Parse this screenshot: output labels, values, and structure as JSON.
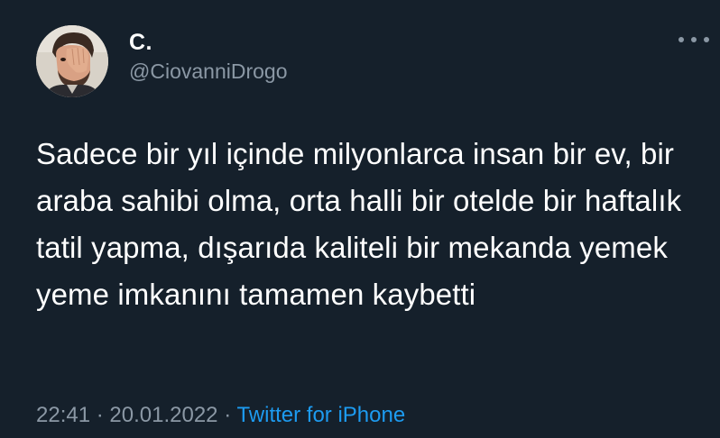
{
  "user": {
    "display_name": "C.",
    "handle": "@CiovanniDrogo"
  },
  "tweet": {
    "text": "Sadece bir yıl içinde milyonlarca insan bir ev, bir araba sahibi olma, orta halli bir otelde bir haftalık tatil yapma, dışarıda kaliteli bir mekanda yemek yeme imkanını tamamen kaybetti"
  },
  "meta": {
    "time": "22:41",
    "separator": "·",
    "date": "20.01.2022",
    "source": "Twitter for iPhone"
  },
  "icons": {
    "more": "more-icon",
    "avatar": "avatar"
  },
  "colors": {
    "background": "#15202b",
    "text": "#ffffff",
    "secondary": "#8b98a5",
    "accent": "#1d9bf0"
  }
}
